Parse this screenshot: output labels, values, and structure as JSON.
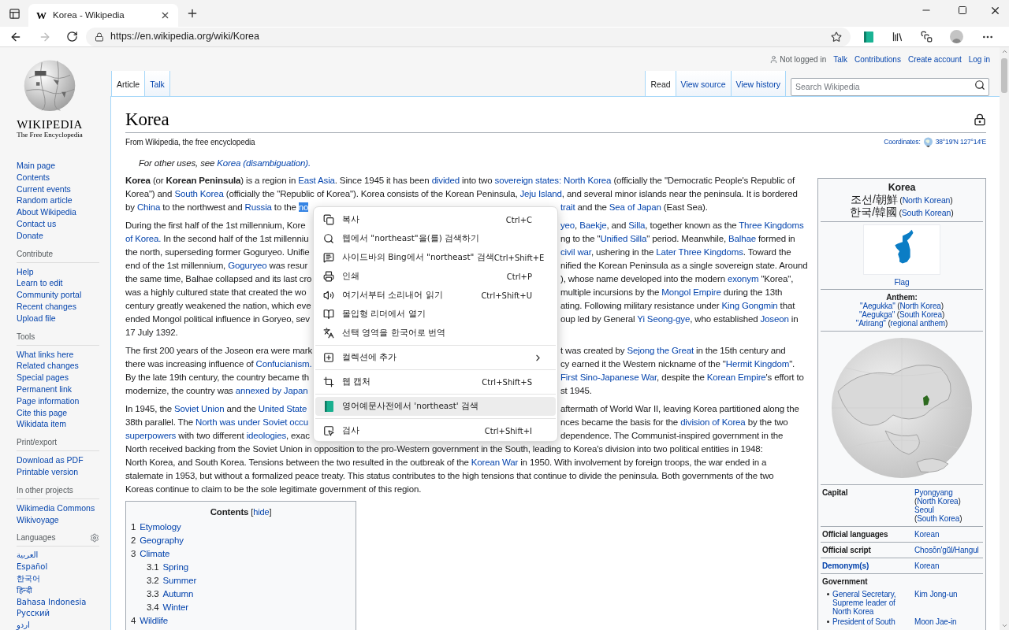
{
  "browser": {
    "tab": {
      "favicon": "W",
      "title": "Korea - Wikipedia"
    },
    "url": "https://en.wikipedia.org/wiki/Korea"
  },
  "personal_tools": [
    {
      "label": "Not logged in",
      "kind": "text"
    },
    {
      "label": "Talk",
      "kind": "link"
    },
    {
      "label": "Contributions",
      "kind": "link"
    },
    {
      "label": "Create account",
      "kind": "link"
    },
    {
      "label": "Log in",
      "kind": "link"
    }
  ],
  "namespace_tabs": [
    {
      "label": "Article",
      "selected": true
    },
    {
      "label": "Talk",
      "selected": false
    }
  ],
  "view_tabs": [
    {
      "label": "Read",
      "selected": true
    },
    {
      "label": "View source",
      "selected": false
    },
    {
      "label": "View history",
      "selected": false
    }
  ],
  "search": {
    "placeholder": "Search Wikipedia"
  },
  "sidebar": {
    "logo": {
      "wordmark": "WIKIPEDIA",
      "tagline": "The Free Encyclopedia"
    },
    "navigation": [
      "Main page",
      "Contents",
      "Current events",
      "Random article",
      "About Wikipedia",
      "Contact us",
      "Donate"
    ],
    "sections": [
      {
        "heading": "Contribute",
        "kind": "links",
        "items": [
          "Help",
          "Learn to edit",
          "Community portal",
          "Recent changes",
          "Upload file"
        ]
      },
      {
        "heading": "Tools",
        "kind": "links",
        "items": [
          "What links here",
          "Related changes",
          "Special pages",
          "Permanent link",
          "Page information",
          "Cite this page",
          "Wikidata item"
        ]
      },
      {
        "heading": "Print/export",
        "kind": "links",
        "items": [
          "Download as PDF",
          "Printable version"
        ]
      },
      {
        "heading": "In other projects",
        "kind": "links",
        "items": [
          "Wikimedia Commons",
          "Wikivoyage"
        ]
      },
      {
        "heading": "Languages",
        "kind": "languages",
        "items": [
          "العربية",
          "Español",
          "한국어",
          "हिन्दी",
          "Bahasa Indonesia",
          "Русский",
          "اردو"
        ]
      }
    ]
  },
  "article": {
    "title": "Korea",
    "subtitle": "From Wikipedia, the free encyclopedia",
    "coordinates": {
      "label": "Coordinates:",
      "value": "38°19′N 127°14′E"
    },
    "hatnote": [
      {
        "text": "For other uses, see "
      },
      {
        "text": "Korea (disambiguation).",
        "kind": "link"
      }
    ],
    "paragraphs": [
      [
        {
          "left": [
            {
              "text": "Korea",
              "kind": "bold"
            },
            {
              "text": " (or "
            },
            {
              "text": "Korean Peninsula",
              "kind": "bold"
            },
            {
              "text": ") is a region in "
            },
            {
              "text": "East Asia",
              "kind": "link"
            },
            {
              "text": ". Since 1945 it has been "
            },
            {
              "text": "divided",
              "kind": "link"
            },
            {
              "text": " into two "
            },
            {
              "text": "sovereign states: North Korea",
              "kind": "link"
            },
            {
              "text": " (officially the \"Democratic People's Republic of"
            }
          ]
        },
        {
          "left": [
            {
              "text": "Korea\") and "
            },
            {
              "text": "South Korea",
              "kind": "link"
            },
            {
              "text": " (officially the \"Republic of Korea\"). Korea consists of the Korean Peninsula, "
            },
            {
              "text": "Jeju Island",
              "kind": "link"
            },
            {
              "text": ", and several minor islands near the peninsula. It is bordered"
            }
          ]
        },
        {
          "left": [
            {
              "text": "by "
            },
            {
              "text": "China",
              "kind": "link"
            },
            {
              "text": " to the northwest and "
            },
            {
              "text": "Russia",
              "kind": "link"
            },
            {
              "text": " to the "
            },
            {
              "text": "no",
              "kind": "selected"
            }
          ],
          "right": [
            {
              "text": "trait",
              "kind": "link"
            },
            {
              "text": " and the "
            },
            {
              "text": "Sea of Japan",
              "kind": "link"
            },
            {
              "text": " (East Sea)."
            }
          ]
        }
      ],
      [
        {
          "left": [
            {
              "text": "During the first half of the 1st millennium, Kore"
            }
          ],
          "right": [
            {
              "text": "yeo",
              "kind": "link"
            },
            {
              "text": ", "
            },
            {
              "text": "Baekje",
              "kind": "link"
            },
            {
              "text": ", and "
            },
            {
              "text": "Silla",
              "kind": "link"
            },
            {
              "text": ", together known as the "
            },
            {
              "text": "Three Kingdoms",
              "kind": "link"
            }
          ]
        },
        {
          "left": [
            {
              "text": "of Korea.",
              "kind": "link"
            },
            {
              "text": " In the second half of the 1st millenniu"
            }
          ],
          "right": [
            {
              "text": "ng to the \""
            },
            {
              "text": "Unified Silla",
              "kind": "link"
            },
            {
              "text": "\" period. Meanwhile, "
            },
            {
              "text": "Balhae",
              "kind": "link"
            },
            {
              "text": " formed in"
            }
          ]
        },
        {
          "left": [
            {
              "text": "the north, superseding former Goguryeo. Unifie"
            }
          ],
          "right": [
            {
              "text": "civil war",
              "kind": "link"
            },
            {
              "text": ", ushering in the "
            },
            {
              "text": "Later Three Kingdoms",
              "kind": "link"
            },
            {
              "text": ". Toward the"
            }
          ]
        },
        {
          "left": [
            {
              "text": "end of the 1st millennium, "
            },
            {
              "text": "Goguryeo",
              "kind": "link"
            },
            {
              "text": " was resur"
            }
          ],
          "right": [
            {
              "text": "nified the Korean Peninsula as a single sovereign state. Around"
            }
          ]
        },
        {
          "left": [
            {
              "text": "the same time, Balhae collapsed and its last cro"
            }
          ],
          "right": [
            {
              "text": "), whose name developed into the modern "
            },
            {
              "text": "exonym",
              "kind": "link"
            },
            {
              "text": " \"Korea\","
            }
          ]
        },
        {
          "left": [
            {
              "text": "was a highly cultured state that created the wo"
            }
          ],
          "right": [
            {
              "text": "multiple incursions by the "
            },
            {
              "text": "Mongol Empire",
              "kind": "link"
            },
            {
              "text": " during the 13th"
            }
          ]
        },
        {
          "left": [
            {
              "text": "century greatly weakened the nation, which eve"
            }
          ],
          "right": [
            {
              "text": "ating. Following military resistance under "
            },
            {
              "text": "King Gongmin",
              "kind": "link"
            },
            {
              "text": " that"
            }
          ]
        },
        {
          "left": [
            {
              "text": "ended Mongol political influence in Goryeo, sev"
            }
          ],
          "right": [
            {
              "text": "oup led by General "
            },
            {
              "text": "Yi Seong-gye",
              "kind": "link"
            },
            {
              "text": ", who established "
            },
            {
              "text": "Joseon",
              "kind": "link"
            },
            {
              "text": " in"
            }
          ]
        },
        {
          "left": [
            {
              "text": "17 July 1392."
            }
          ]
        }
      ],
      [
        {
          "left": [
            {
              "text": "The first 200 years of the Joseon era were mark"
            }
          ],
          "right": [
            {
              "text": "t was created by "
            },
            {
              "text": "Sejong the Great",
              "kind": "link"
            },
            {
              "text": " in the 15th century and"
            }
          ]
        },
        {
          "left": [
            {
              "text": "there was increasing influence of "
            },
            {
              "text": "Confucianism.",
              "kind": "link"
            }
          ],
          "right": [
            {
              "text": "cy earned it the Western nickname of the \""
            },
            {
              "text": "Hermit Kingdom",
              "kind": "link"
            },
            {
              "text": "\"."
            }
          ]
        },
        {
          "left": [
            {
              "text": "By the late 19th century, the country became th"
            }
          ],
          "right": [
            {
              "text": "First Sino-Japanese War",
              "kind": "link"
            },
            {
              "text": ", despite the "
            },
            {
              "text": "Korean Empire",
              "kind": "link"
            },
            {
              "text": "'s effort to"
            }
          ]
        },
        {
          "left": [
            {
              "text": "modernize, the country was "
            },
            {
              "text": "annexed by Japan",
              "kind": "link"
            }
          ],
          "right": [
            {
              "text": "st 1945."
            }
          ]
        }
      ],
      [
        {
          "left": [
            {
              "text": "In 1945, the "
            },
            {
              "text": "Soviet Union",
              "kind": "link"
            },
            {
              "text": " and the "
            },
            {
              "text": "United State",
              "kind": "link"
            }
          ],
          "right": [
            {
              "text": "aftermath of World War II, leaving Korea partitioned along the"
            }
          ]
        },
        {
          "left": [
            {
              "text": "38th parallel. The "
            },
            {
              "text": "North was under Soviet occu",
              "kind": "link"
            }
          ],
          "right": [
            {
              "text": "nces became the basis for the "
            },
            {
              "text": "division of Korea",
              "kind": "link"
            },
            {
              "text": " by the two"
            }
          ]
        },
        {
          "left": [
            {
              "text": "superpowers",
              "kind": "link"
            },
            {
              "text": " with two different "
            },
            {
              "text": "ideologies",
              "kind": "link"
            },
            {
              "text": ", exac"
            }
          ],
          "right": [
            {
              "text": "dependence. The Communist-inspired government in the"
            }
          ]
        },
        {
          "left": [
            {
              "text": "North received backing from the Soviet Union in opposition to the pro-Western government in the South, leading to Korea's division into two political entities in 1948:"
            }
          ]
        },
        {
          "left": [
            {
              "text": "North Korea, and South Korea. Tensions between the two resulted in the outbreak of the "
            },
            {
              "text": "Korean War",
              "kind": "link"
            },
            {
              "text": " in 1950. With involvement by foreign troops, the war ended in a"
            }
          ]
        },
        {
          "left": [
            {
              "text": "stalemate in 1953, but without a formalized peace treaty. This status contributes to the high tensions that continue to divide the peninsula. Both governments of the two"
            }
          ]
        },
        {
          "left": [
            {
              "text": "Koreas continue to claim to be the sole legitimate government of this region."
            }
          ]
        }
      ]
    ],
    "contents": {
      "title": "Contents",
      "toggle_open": "[",
      "toggle": "hide",
      "toggle_close": "]",
      "items": [
        {
          "number": "1",
          "label": "Etymology"
        },
        {
          "number": "2",
          "label": "Geography"
        },
        {
          "number": "3",
          "label": "Climate",
          "children": [
            {
              "number": "3.1",
              "label": "Spring"
            },
            {
              "number": "3.2",
              "label": "Summer"
            },
            {
              "number": "3.3",
              "label": "Autumn"
            },
            {
              "number": "3.4",
              "label": "Winter"
            }
          ]
        },
        {
          "number": "4",
          "label": "Wildlife"
        }
      ]
    }
  },
  "infobox": {
    "title": "Korea",
    "native_names": [
      [
        {
          "text": "조선/朝鮮",
          "kind": "native"
        },
        {
          "text": " ("
        },
        {
          "text": "North Korean",
          "kind": "link"
        },
        {
          "text": ")"
        }
      ],
      [
        {
          "text": "한국/韓國",
          "kind": "native"
        },
        {
          "text": " ("
        },
        {
          "text": "South Korean",
          "kind": "link"
        },
        {
          "text": ")"
        }
      ]
    ],
    "flag_caption": "Flag",
    "anthem_heading": "Anthem:",
    "anthems": [
      [
        {
          "text": "\"Aegukka\"",
          "kind": "link"
        },
        {
          "text": " ("
        },
        {
          "text": "North Korea",
          "kind": "link"
        },
        {
          "text": ")"
        }
      ],
      [
        {
          "text": "\"Aegukga\"",
          "kind": "link"
        },
        {
          "text": " ("
        },
        {
          "text": "South Korea",
          "kind": "link"
        },
        {
          "text": ")"
        }
      ],
      [
        {
          "text": "\"Arirang\"",
          "kind": "link"
        },
        {
          "text": " ("
        },
        {
          "text": "regional anthem",
          "kind": "link"
        },
        {
          "text": ")"
        }
      ]
    ],
    "rows": [
      {
        "label": [
          {
            "text": "Capital",
            "kind": "bold"
          }
        ],
        "value": [
          [
            {
              "text": "Pyongyang",
              "kind": "link"
            },
            {
              "text": " ("
            },
            {
              "text": "North Korea",
              "kind": "link"
            },
            {
              "text": ")"
            }
          ],
          [
            {
              "text": "Seoul",
              "kind": "link"
            },
            {
              "text": " ("
            },
            {
              "text": "South Korea",
              "kind": "link"
            },
            {
              "text": ")"
            }
          ]
        ]
      },
      {
        "label": [
          {
            "text": "Official languages",
            "kind": "bold"
          }
        ],
        "value": [
          [
            {
              "text": "Korean",
              "kind": "link"
            }
          ]
        ]
      },
      {
        "label": [
          {
            "text": "Official script",
            "kind": "bold"
          }
        ],
        "value": [
          [
            {
              "text": "Chosŏn'gŭl/Hangul",
              "kind": "link"
            }
          ]
        ]
      },
      {
        "label": [
          {
            "text": "Demonym(s)",
            "kind": "boldlink"
          }
        ],
        "value": [
          [
            {
              "text": "Korean",
              "kind": "link"
            }
          ]
        ]
      }
    ],
    "section": {
      "heading": "Government",
      "rows": [
        {
          "label": [
            {
              "text": "General Secretary, Supreme leader of North Korea",
              "kind": "link"
            }
          ],
          "value": [
            {
              "text": "Kim Jong-un",
              "kind": "link"
            }
          ]
        },
        {
          "label": [
            {
              "text": "President of South",
              "kind": "link"
            }
          ],
          "value": [
            {
              "text": "Moon Jae-in",
              "kind": "link"
            }
          ]
        }
      ]
    }
  },
  "context_menu": {
    "groups": [
      [
        {
          "label": "복사",
          "shortcut": "Ctrl+C",
          "submenu": false,
          "selected": false
        },
        {
          "label": "웹에서 \"northeast\"을(를) 검색하기",
          "submenu": false,
          "selected": false
        },
        {
          "label": "사이드바의 Bing에서 \"northeast\" 검색",
          "shortcut": "Ctrl+Shift+E",
          "submenu": false,
          "selected": false
        },
        {
          "label": "인쇄",
          "shortcut": "Ctrl+P",
          "submenu": false,
          "selected": false
        },
        {
          "label": "여기서부터 소리내어 읽기",
          "shortcut": "Ctrl+Shift+U",
          "submenu": false,
          "selected": false
        },
        {
          "label": "몰입형 리더에서 열기",
          "submenu": false,
          "selected": false
        },
        {
          "label": "선택 영역을 한국어로 번역",
          "submenu": false,
          "selected": false
        }
      ],
      [
        {
          "label": "컬렉션에 추가",
          "submenu": true,
          "selected": false
        }
      ],
      [
        {
          "label": "웹 캡처",
          "shortcut": "Ctrl+Shift+S",
          "submenu": false,
          "selected": false
        }
      ],
      [
        {
          "label": "영어예문사전에서 'northeast' 검색",
          "submenu": false,
          "selected": true
        }
      ],
      [
        {
          "label": "검사",
          "shortcut": "Ctrl+Shift+I",
          "submenu": false,
          "selected": false
        }
      ]
    ]
  }
}
